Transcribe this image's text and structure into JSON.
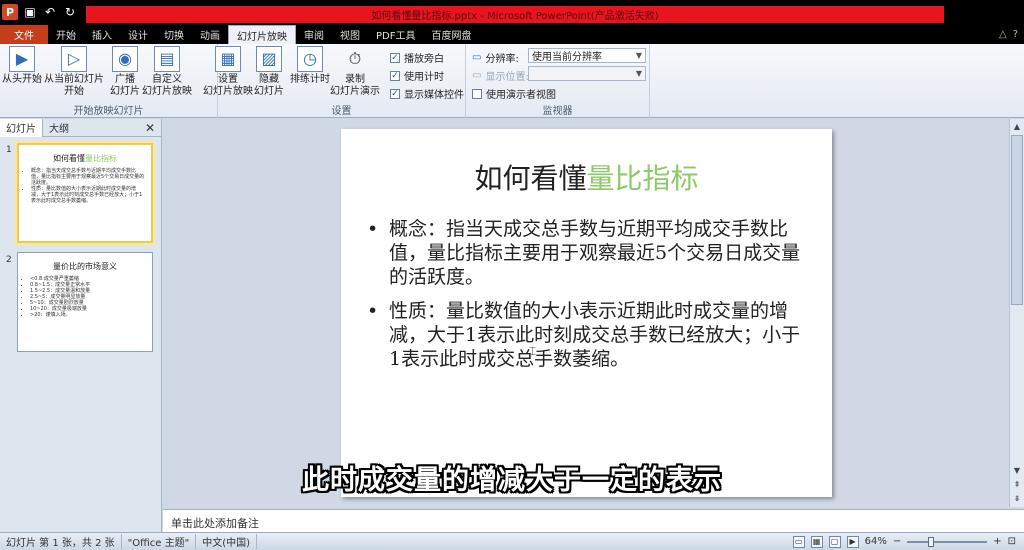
{
  "window": {
    "title": "如何看懂量比指标.pptx - Microsoft PowerPoint(产品激活失败)"
  },
  "menu": {
    "file": "文件",
    "tabs": [
      "开始",
      "插入",
      "设计",
      "切换",
      "动画",
      "幻灯片放映",
      "审阅",
      "视图",
      "PDF工具",
      "百度网盘"
    ],
    "active": "幻灯片放映"
  },
  "ribbon": {
    "start_group": {
      "label": "开始放映幻灯片",
      "from_start": "从头开始",
      "from_current_1": "从当前幻灯片",
      "from_current_2": "开始",
      "broadcast_1": "广播",
      "broadcast_2": "幻灯片",
      "custom_1": "自定义",
      "custom_2": "幻灯片放映"
    },
    "setup_group": {
      "label": "设置",
      "setup_1": "设置",
      "setup_2": "幻灯片放映",
      "hide_1": "隐藏",
      "hide_2": "幻灯片",
      "rehearse": "排练计时",
      "record_1": "录制",
      "record_2": "幻灯片演示",
      "cb_narration": "播放旁白",
      "cb_timing": "使用计时",
      "cb_media": "显示媒体控件"
    },
    "monitor_group": {
      "label": "监视器",
      "resolution_label": "分辨率:",
      "resolution_value": "使用当前分辨率",
      "show_on_label": "显示位置:",
      "presenter_view": "使用演示者视图"
    }
  },
  "left_pane": {
    "tab_slides": "幻灯片",
    "tab_outline": "大纲",
    "slides": [
      {
        "num": "1",
        "title_a": "如何看懂",
        "title_b": "量比指标",
        "bullets": [
          "概念：指当天成交总手数与近期平均成交手数比值，量比指标主要用于观察最近5个交易日成交量的活跃度。",
          "性质：量比数值的大小表示近期此时成交量的增减，大于1表示此时刻成交总手数已经放大；小于1表示此时成交总手数萎缩。"
        ]
      },
      {
        "num": "2",
        "title_a": "量价比的市场意义",
        "bullets": [
          "<0.8:成交量严重萎缩",
          "0.8~1.5：成交量正常水平",
          "1.5~2.5：成交量温和放量",
          "2.5~5：成交量明显放量",
          "5~10：成交量剧烈放量",
          "10~20：成交量极端放量",
          ">20：谨慎入场。"
        ]
      }
    ]
  },
  "slide": {
    "title_a": "如何看懂",
    "title_b": "量比指标",
    "bullets": [
      "概念：指当天成交总手数与近期平均成交手数比值，量比指标主要用于观察最近5个交易日成交量的活跃度。",
      "性质：量比数值的大小表示近期此时成交量的增减，大于1表示此时刻成交总手数已经放大；小于1表示此时成交总手数萎缩。"
    ]
  },
  "subtitle": "此时成交量的增减大于一定的表示",
  "notes_placeholder": "单击此处添加备注",
  "status": {
    "slide_info": "幻灯片 第 1 张，共 2 张",
    "theme": "\"Office 主题\"",
    "language": "中文(中国)",
    "zoom": "64%",
    "zoom_fraction": 0.64
  },
  "colors": {
    "accent_green": "#8fc86a",
    "file_tab": "#c43e1c",
    "title_red": "#e8141e"
  }
}
